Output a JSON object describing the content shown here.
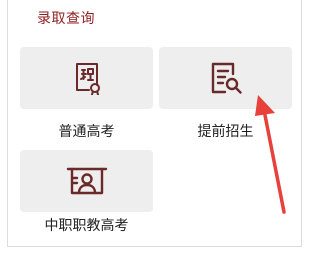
{
  "section": {
    "title": "录取查询"
  },
  "cards": [
    {
      "label": "普通高考",
      "icon": "certificate-badge-icon"
    },
    {
      "label": "提前招生",
      "icon": "document-search-icon"
    },
    {
      "label": "中职职教高考",
      "icon": "id-card-person-icon"
    }
  ],
  "annotation": {
    "arrow_color": "#e8403a"
  },
  "colors": {
    "accent": "#8f1f1f",
    "icon": "#6b2a2a",
    "card_bg": "#eeeeee"
  }
}
